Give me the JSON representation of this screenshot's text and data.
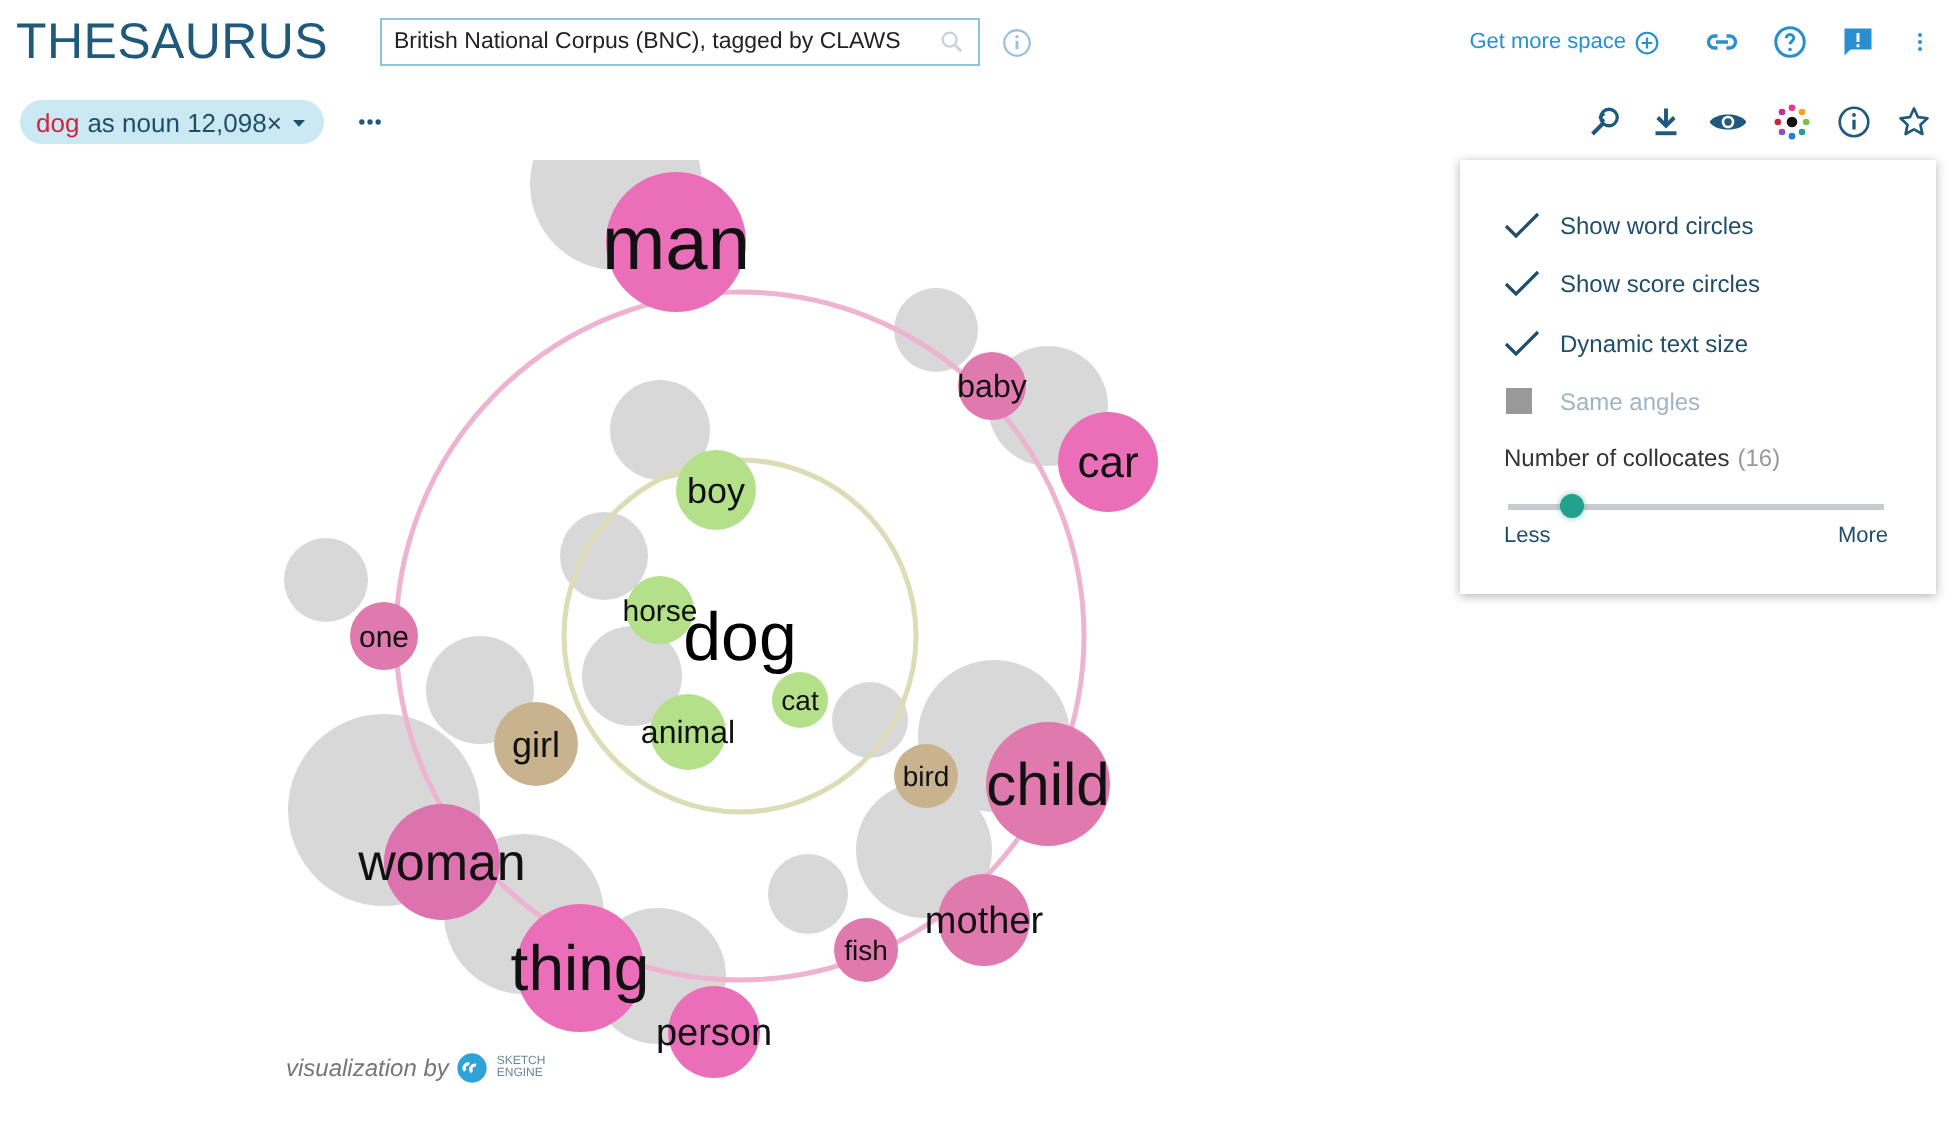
{
  "app_title": "THESAURUS",
  "corpus_field": {
    "value": "British National Corpus (BNC), tagged by CLAWS"
  },
  "header_links": {
    "more_space": "Get more space"
  },
  "query_chip": {
    "word": "dog",
    "rest": "as noun 12,098×"
  },
  "graph": {
    "headword": "dog",
    "words": [
      {
        "word": "man",
        "color": "#ea6fb8"
      },
      {
        "word": "baby",
        "color": "#e07aae"
      },
      {
        "word": "car",
        "color": "#ea6fb8"
      },
      {
        "word": "boy",
        "color": "#b4e08a"
      },
      {
        "word": "one",
        "color": "#e07aae"
      },
      {
        "word": "horse",
        "color": "#b4e08a"
      },
      {
        "word": "cat",
        "color": "#b4e08a"
      },
      {
        "word": "animal",
        "color": "#b4e08a"
      },
      {
        "word": "girl",
        "color": "#c9b28e"
      },
      {
        "word": "bird",
        "color": "#c9b28e"
      },
      {
        "word": "child",
        "color": "#e07aae"
      },
      {
        "word": "woman",
        "color": "#dd73ae"
      },
      {
        "word": "mother",
        "color": "#e07aae"
      },
      {
        "word": "fish",
        "color": "#e07aae"
      },
      {
        "word": "thing",
        "color": "#ea6fb8"
      },
      {
        "word": "person",
        "color": "#ea6fb8"
      }
    ]
  },
  "options_panel": {
    "options": [
      {
        "label": "Show word circles",
        "checked": true,
        "disabled": false
      },
      {
        "label": "Show score circles",
        "checked": true,
        "disabled": false
      },
      {
        "label": "Dynamic text size",
        "checked": true,
        "disabled": false
      },
      {
        "label": "Same angles",
        "checked": false,
        "disabled": true
      }
    ],
    "slider": {
      "label": "Number of collocates",
      "count": "(16)",
      "level": 0.17,
      "min_label": "Less",
      "max_label": "More"
    }
  },
  "footer": {
    "text": "visualization by",
    "logo_text": "SKETCH ENGINE"
  }
}
